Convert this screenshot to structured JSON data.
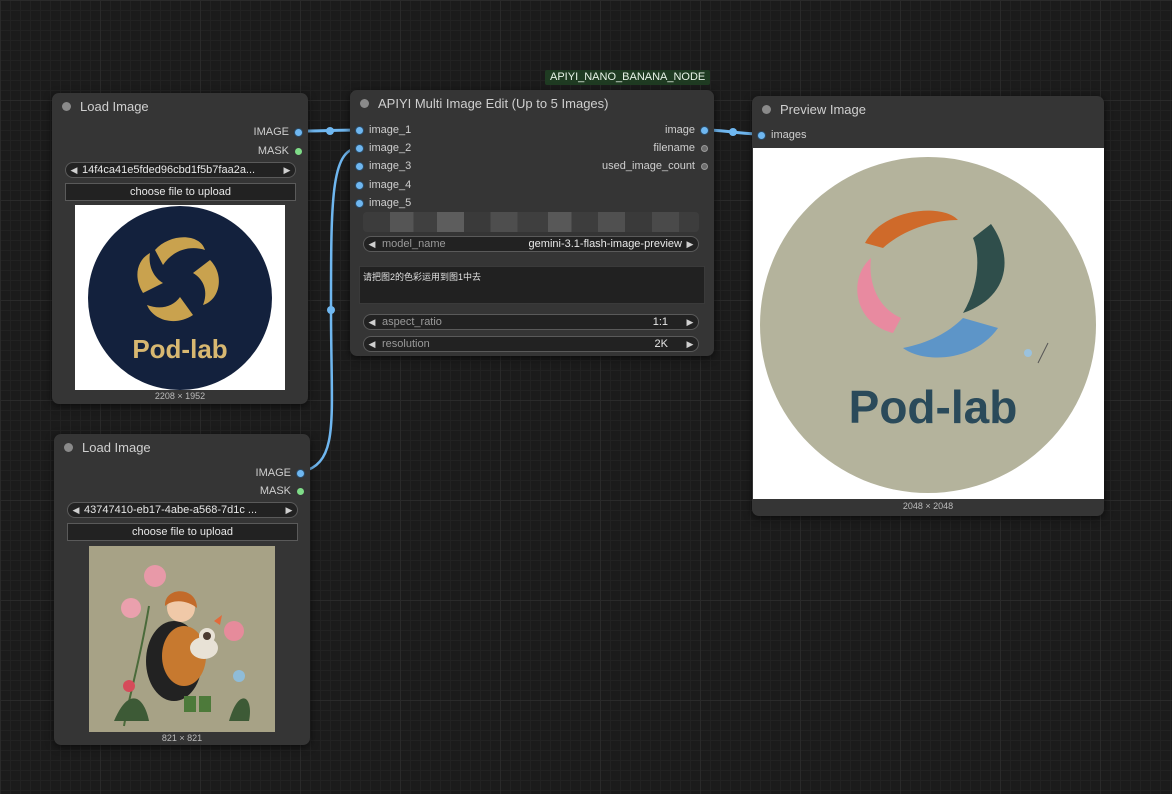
{
  "canvas": {
    "background": "#1b1b1b"
  },
  "node_tag": "APIYI_NANO_BANANA_NODE",
  "load_image_1": {
    "title": "Load Image",
    "outputs": [
      "IMAGE",
      "MASK"
    ],
    "file": "14f4ca41e5fded96cbd1f5b7faa2a...",
    "upload_label": "choose file to upload",
    "preview_text": "Pod-lab",
    "dimensions": "2208 × 1952"
  },
  "load_image_2": {
    "title": "Load Image",
    "outputs": [
      "IMAGE",
      "MASK"
    ],
    "file": "43747410-eb17-4abe-a568-7d1c ...",
    "upload_label": "choose file to upload",
    "dimensions": "821 × 821"
  },
  "apiyi_node": {
    "title": "APIYI Multi Image Edit (Up to 5 Images)",
    "inputs": [
      "image_1",
      "image_2",
      "image_3",
      "image_4",
      "image_5"
    ],
    "outputs": [
      "image",
      "filename",
      "used_image_count"
    ],
    "model_name_label": "model_name",
    "model_name_value": "gemini-3.1-flash-image-preview",
    "prompt": "请把图2的色彩运用到图1中去",
    "aspect_ratio_label": "aspect_ratio",
    "aspect_ratio_value": "1:1",
    "resolution_label": "resolution",
    "resolution_value": "2K"
  },
  "preview_node": {
    "title": "Preview Image",
    "input": "images",
    "preview_text": "Pod-lab",
    "dimensions": "2048 × 2048"
  },
  "colors": {
    "link_blue": "#6fb7f0",
    "mask_green": "#7fdc88",
    "node_bg": "#353535",
    "tag_bg": "#1f3b22"
  }
}
